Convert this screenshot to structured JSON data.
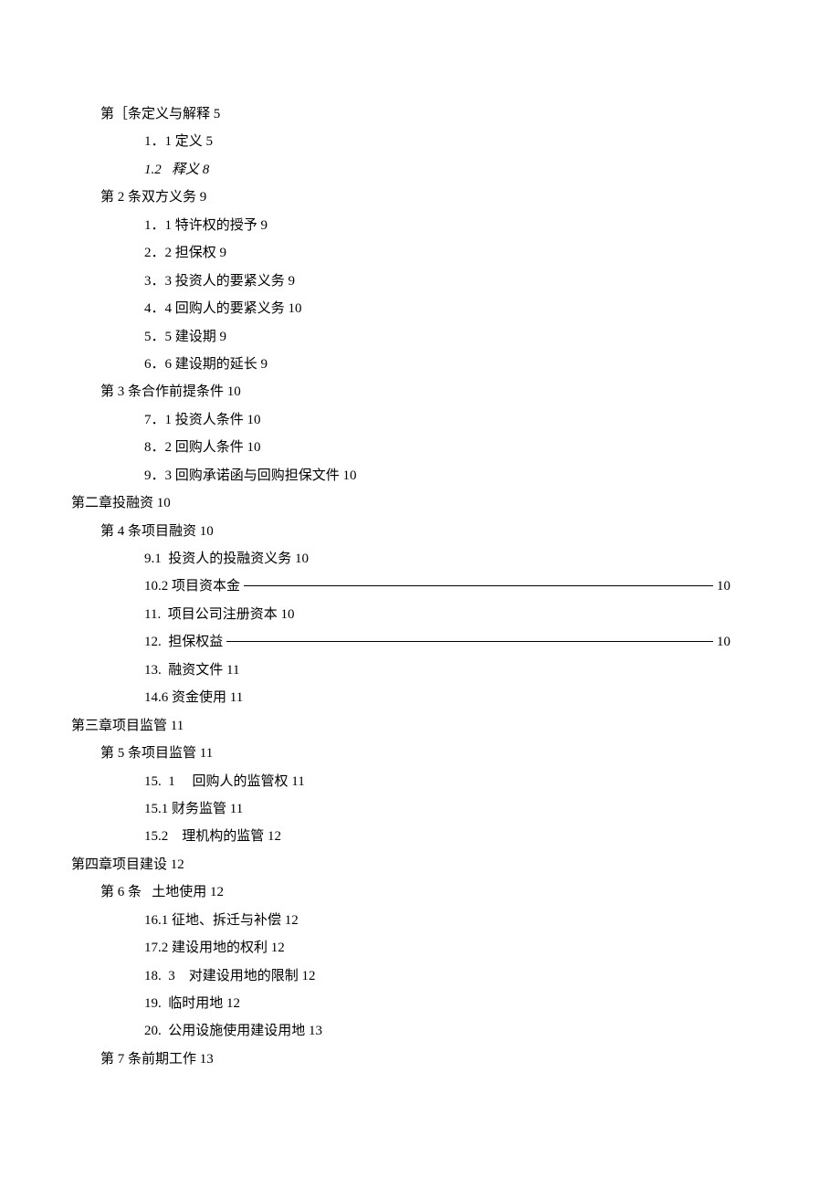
{
  "toc": [
    {
      "cls": "indent-1",
      "text": "第［条定义与解释 5"
    },
    {
      "cls": "indent-2",
      "text": "1．1 定义 5"
    },
    {
      "cls": "indent-2 italic",
      "text": "1.2   释义 8"
    },
    {
      "cls": "indent-1",
      "text": "第 2 条双方义务 9"
    },
    {
      "cls": "indent-2",
      "text": "1．1 特许权的授予 9"
    },
    {
      "cls": "indent-2",
      "text": "2．2 担保权 9"
    },
    {
      "cls": "indent-2",
      "text": "3．3 投资人的要紧义务 9"
    },
    {
      "cls": "indent-2",
      "text": "4．4 回购人的要紧义务 10"
    },
    {
      "cls": "indent-2",
      "text": "5．5 建设期 9"
    },
    {
      "cls": "indent-2",
      "text": "6．6 建设期的延长 9"
    },
    {
      "cls": "indent-1",
      "text": "第 3 条合作前提条件 10"
    },
    {
      "cls": "indent-2",
      "text": "7．1 投资人条件 10"
    },
    {
      "cls": "indent-2",
      "text": "8．2 回购人条件 10"
    },
    {
      "cls": "indent-2",
      "text": "9．3 回购承诺函与回购担保文件 10"
    },
    {
      "cls": "indent-0",
      "text": "第二章投融资 10"
    },
    {
      "cls": "indent-1",
      "text": "第 4 条项目融资 10"
    },
    {
      "cls": "indent-2",
      "text": "9.1  投资人的投融资义务 10"
    },
    {
      "cls": "indent-2",
      "left": "10.2 项目资本金",
      "fill": true,
      "right": "10"
    },
    {
      "cls": "indent-2",
      "text": "11.  项目公司注册资本 10"
    },
    {
      "cls": "indent-2",
      "left": "12.  担保权益",
      "fill": true,
      "right": "10"
    },
    {
      "cls": "indent-2",
      "text": "13.  融资文件 11"
    },
    {
      "cls": "indent-2",
      "text": "14.6 资金使用 11"
    },
    {
      "cls": "indent-0",
      "text": "第三章项目监管 11"
    },
    {
      "cls": "indent-1",
      "text": "第 5 条项目监管 11"
    },
    {
      "cls": "indent-2",
      "text": "15.  1     回购人的监管权 11"
    },
    {
      "cls": "indent-2",
      "text": "15.1 财务监管 11"
    },
    {
      "cls": "indent-2",
      "text": "15.2    理机构的监管 12"
    },
    {
      "cls": "indent-0",
      "text": "第四章项目建设 12"
    },
    {
      "cls": "indent-1",
      "text": "第 6 条   土地使用 12"
    },
    {
      "cls": "indent-2",
      "text": "16.1 征地、拆迁与补偿 12"
    },
    {
      "cls": "indent-2",
      "text": "17.2 建设用地的权利 12"
    },
    {
      "cls": "indent-2",
      "text": "18.  3    对建设用地的限制 12"
    },
    {
      "cls": "indent-2",
      "text": "19.  临时用地 12"
    },
    {
      "cls": "indent-2",
      "text": "20.  公用设施使用建设用地 13"
    },
    {
      "cls": "indent-1",
      "text": "第 7 条前期工作 13"
    }
  ]
}
